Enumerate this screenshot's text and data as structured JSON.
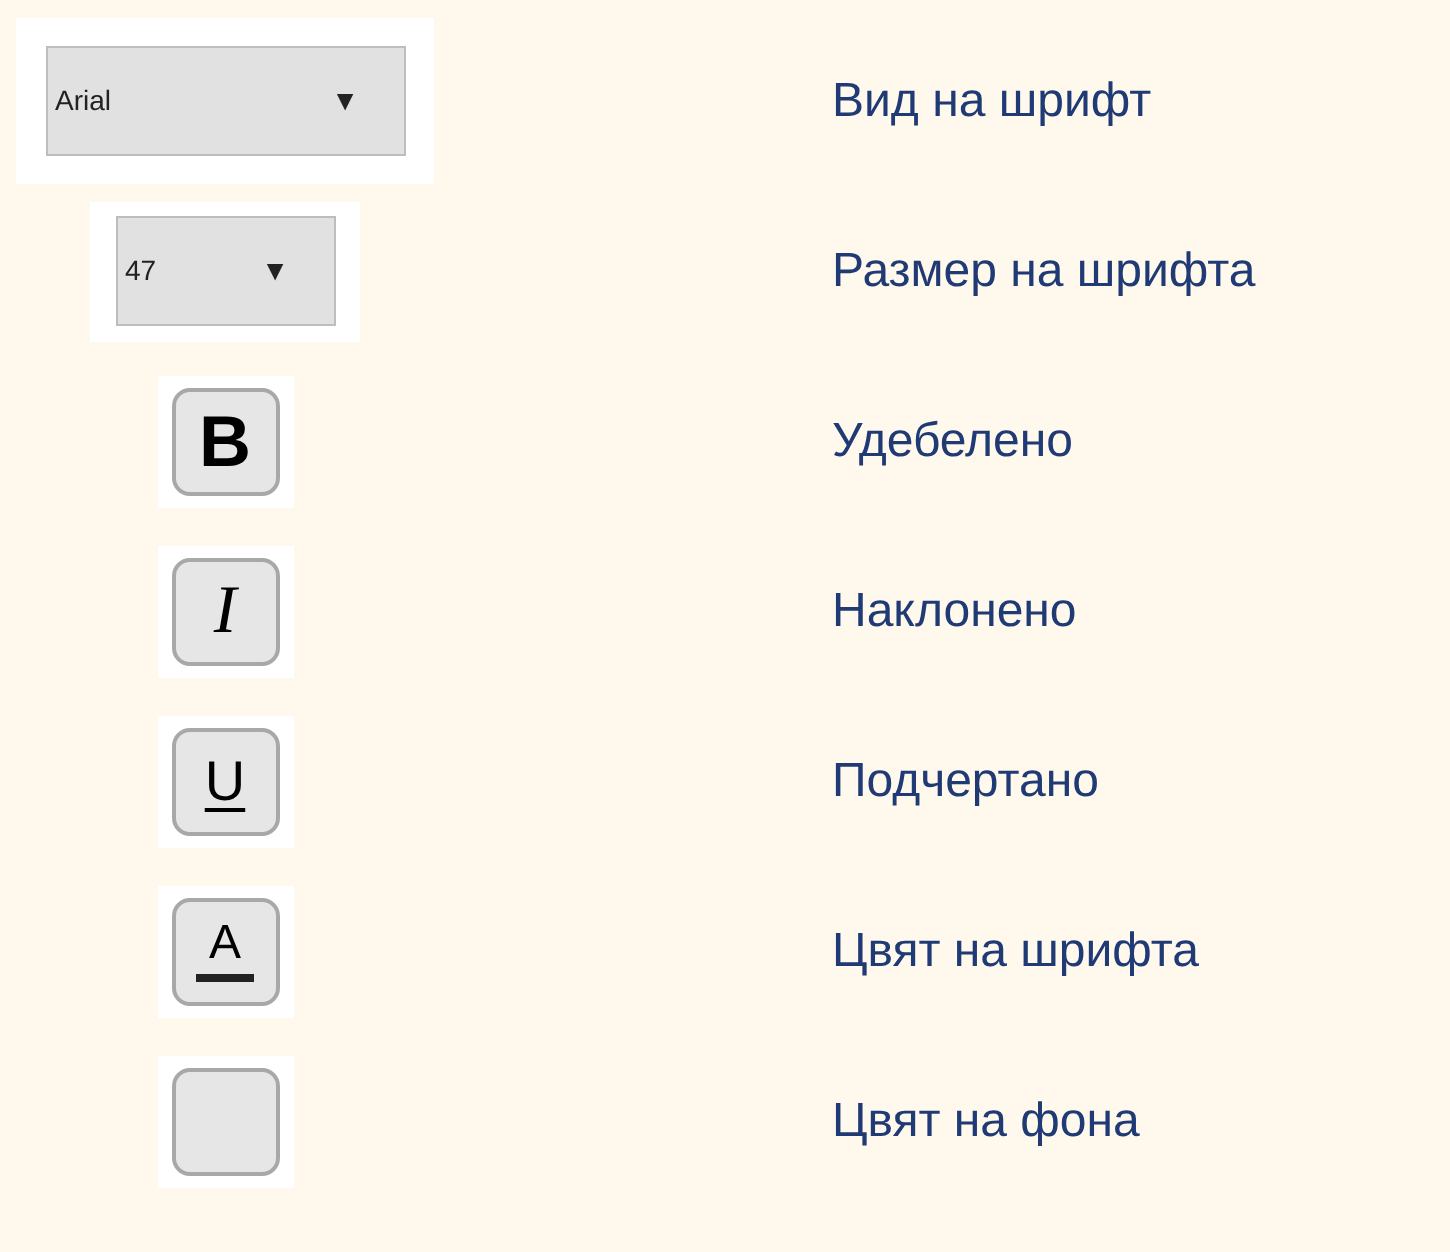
{
  "items": [
    {
      "kind": "dropdown",
      "value": "Arial",
      "caret": "▼",
      "label": "Вид на шрифт"
    },
    {
      "kind": "dropdown-small",
      "value": "47",
      "caret": "▼",
      "label": "Размер на шрифта"
    },
    {
      "kind": "bold",
      "text": "B",
      "label": "Удебелено"
    },
    {
      "kind": "italic",
      "text": "I",
      "label": "Наклонено"
    },
    {
      "kind": "underline",
      "text": "U",
      "label": "Подчертано"
    },
    {
      "kind": "font-color",
      "text": "A",
      "label": "Цвят на шрифта"
    },
    {
      "kind": "background-color",
      "label": "Цвят на фона"
    }
  ]
}
